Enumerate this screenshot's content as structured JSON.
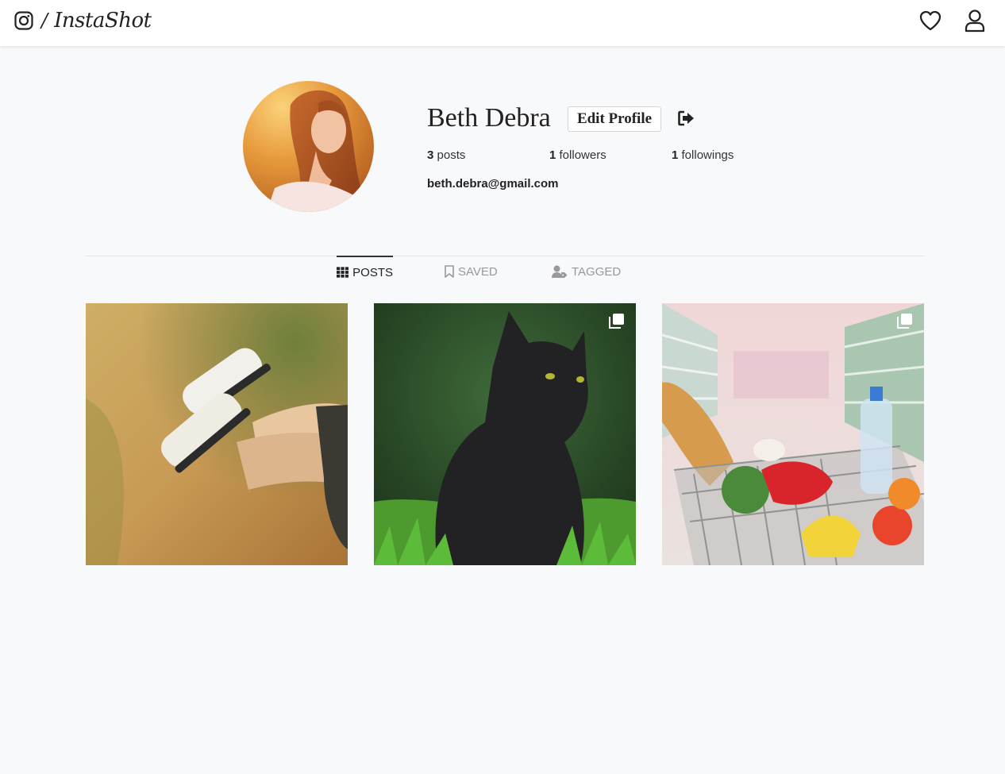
{
  "brand": {
    "separator": "/",
    "name": "InstaShot"
  },
  "icons": {
    "logo": "instagram-icon",
    "heart": "heart-icon",
    "user": "user-icon",
    "logout": "logout-icon",
    "grid": "grid-icon",
    "bookmark": "bookmark-icon",
    "tagged": "user-tag-icon",
    "multi": "multiple-images-icon"
  },
  "profile": {
    "username": "Beth Debra",
    "edit_label": "Edit Profile",
    "email": "beth.debra@gmail.com",
    "stats": {
      "posts": {
        "count": "3",
        "label": "posts"
      },
      "followers": {
        "count": "1",
        "label": "followers"
      },
      "followings": {
        "count": "1",
        "label": "followings"
      }
    }
  },
  "tabs": {
    "posts": "POSTS",
    "saved": "SAVED",
    "tagged": "TAGGED",
    "active": "POSTS"
  },
  "posts": [
    {
      "subject": "sneakers",
      "multiple": false
    },
    {
      "subject": "black-cat",
      "multiple": true
    },
    {
      "subject": "grocery-cart",
      "multiple": true
    }
  ],
  "colors": {
    "page_bg": "#f8f9fb",
    "text": "#222222",
    "muted": "#999999"
  }
}
